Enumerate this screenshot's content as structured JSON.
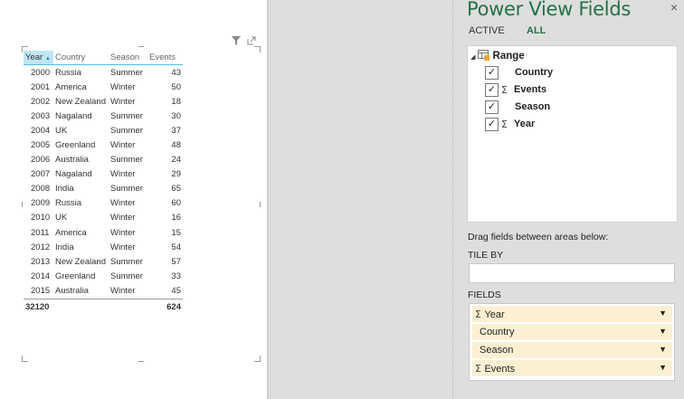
{
  "table": {
    "columns": [
      "Year",
      "Country",
      "Season",
      "Events"
    ],
    "sort_indicator": "▲",
    "rows": [
      [
        "2000",
        "Russia",
        "Summer",
        "43"
      ],
      [
        "2001",
        "America",
        "Winter",
        "50"
      ],
      [
        "2002",
        "New Zealand",
        "Winter",
        "18"
      ],
      [
        "2003",
        "Nagaland",
        "Summer",
        "30"
      ],
      [
        "2004",
        "UK",
        "Summer",
        "37"
      ],
      [
        "2005",
        "Greenland",
        "Winter",
        "48"
      ],
      [
        "2006",
        "Australia",
        "Summer",
        "24"
      ],
      [
        "2007",
        "Nagaland",
        "Winter",
        "29"
      ],
      [
        "2008",
        "India",
        "Summer",
        "65"
      ],
      [
        "2009",
        "Russia",
        "Winter",
        "60"
      ],
      [
        "2010",
        "UK",
        "Winter",
        "16"
      ],
      [
        "2011",
        "America",
        "Winter",
        "15"
      ],
      [
        "2012",
        "India",
        "Winter",
        "54"
      ],
      [
        "2013",
        "New Zealand",
        "Summer",
        "57"
      ],
      [
        "2014",
        "Greenland",
        "Summer",
        "33"
      ],
      [
        "2015",
        "Australia",
        "Winter",
        "45"
      ]
    ],
    "totals": [
      "32120",
      "",
      "",
      "624"
    ],
    "icons": [
      "filter-icon",
      "popout-icon"
    ]
  },
  "panel": {
    "title": "Power View Fields",
    "close": "×",
    "tabs": [
      {
        "label": "ACTIVE",
        "selected": false
      },
      {
        "label": "ALL",
        "selected": true
      }
    ],
    "tree": {
      "expand_glyph": "◢",
      "root": "Range",
      "fields": [
        {
          "name": "Country",
          "checked": true,
          "sigma": false
        },
        {
          "name": "Events",
          "checked": true,
          "sigma": true
        },
        {
          "name": "Season",
          "checked": true,
          "sigma": false
        },
        {
          "name": "Year",
          "checked": true,
          "sigma": true
        }
      ]
    },
    "drag_hint": "Drag fields between areas below:",
    "tile_by_label": "TILE BY",
    "fields_label": "FIELDS",
    "well": [
      {
        "name": "Year",
        "sigma": true
      },
      {
        "name": "Country",
        "sigma": false
      },
      {
        "name": "Season",
        "sigma": false
      },
      {
        "name": "Events",
        "sigma": true
      }
    ],
    "accent_color": "#217346",
    "well_item_color": "#fdf0d2"
  }
}
